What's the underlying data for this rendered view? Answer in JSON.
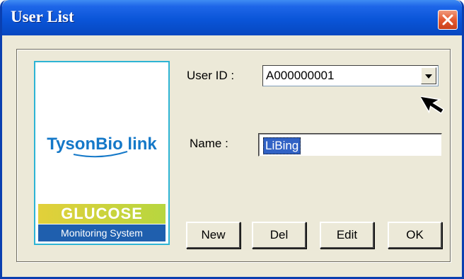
{
  "window": {
    "title": "User List"
  },
  "logo": {
    "brand": "TysonBio link",
    "product_line1": "GLUCOSE",
    "product_line2": "Monitoring System"
  },
  "form": {
    "user_id_label": "User ID :",
    "user_id_value": "A000000001",
    "name_label": "Name :",
    "name_value": "LiBing"
  },
  "buttons": {
    "new_label": "New",
    "del_label": "Del",
    "edit_label": "Edit",
    "ok_label": "OK"
  },
  "colors": {
    "titlebar": "#0a55d8",
    "dialog_bg": "#ece9d8",
    "selection": "#3162c5",
    "logo_border": "#2db4d4",
    "brand_blue": "#1478c8",
    "close_button": "#e45a31"
  },
  "icons": {
    "close": "close-icon",
    "dropdown": "chevron-down-icon",
    "pointer": "mouse-pointer-icon"
  }
}
